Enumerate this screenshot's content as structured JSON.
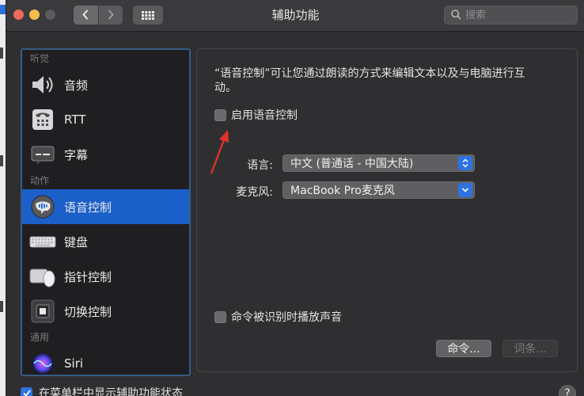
{
  "window": {
    "title": "辅助功能",
    "search_placeholder": "搜索"
  },
  "sidebar": {
    "sections": [
      {
        "header": "听觉",
        "items": [
          {
            "label": "音频",
            "icon": "speaker-icon"
          },
          {
            "label": "RTT",
            "icon": "rtt-phone-icon"
          },
          {
            "label": "字幕",
            "icon": "captions-icon"
          }
        ]
      },
      {
        "header": "动作",
        "items": [
          {
            "label": "语音控制",
            "icon": "voice-control-icon",
            "selected": true
          },
          {
            "label": "键盘",
            "icon": "keyboard-icon"
          },
          {
            "label": "指针控制",
            "icon": "pointer-control-icon"
          },
          {
            "label": "切换控制",
            "icon": "switch-control-icon"
          }
        ]
      },
      {
        "header": "通用",
        "items": [
          {
            "label": "Siri",
            "icon": "siri-icon"
          }
        ]
      }
    ]
  },
  "panel": {
    "description": "“语音控制”可让您通过朗读的方式来编辑文本以及与电脑进行互动。",
    "enable_label": "启用语音控制",
    "enable_checked": false,
    "language_label": "语言:",
    "language_value": "中文 (普通话 - 中国大陆)",
    "mic_label": "麦克风:",
    "mic_value": "MacBook Pro麦克风",
    "play_sound_label": "命令被识别时播放声音",
    "play_sound_checked": false,
    "commands_button": "命令...",
    "vocabulary_button": "词条..."
  },
  "footer": {
    "menubar_label": "在菜单栏中显示辅助功能状态",
    "menubar_checked": true,
    "help_label": "?"
  },
  "colors": {
    "selection": "#1b5fc9",
    "accent": "#2d73e0",
    "annotation_arrow": "#e0322b"
  }
}
